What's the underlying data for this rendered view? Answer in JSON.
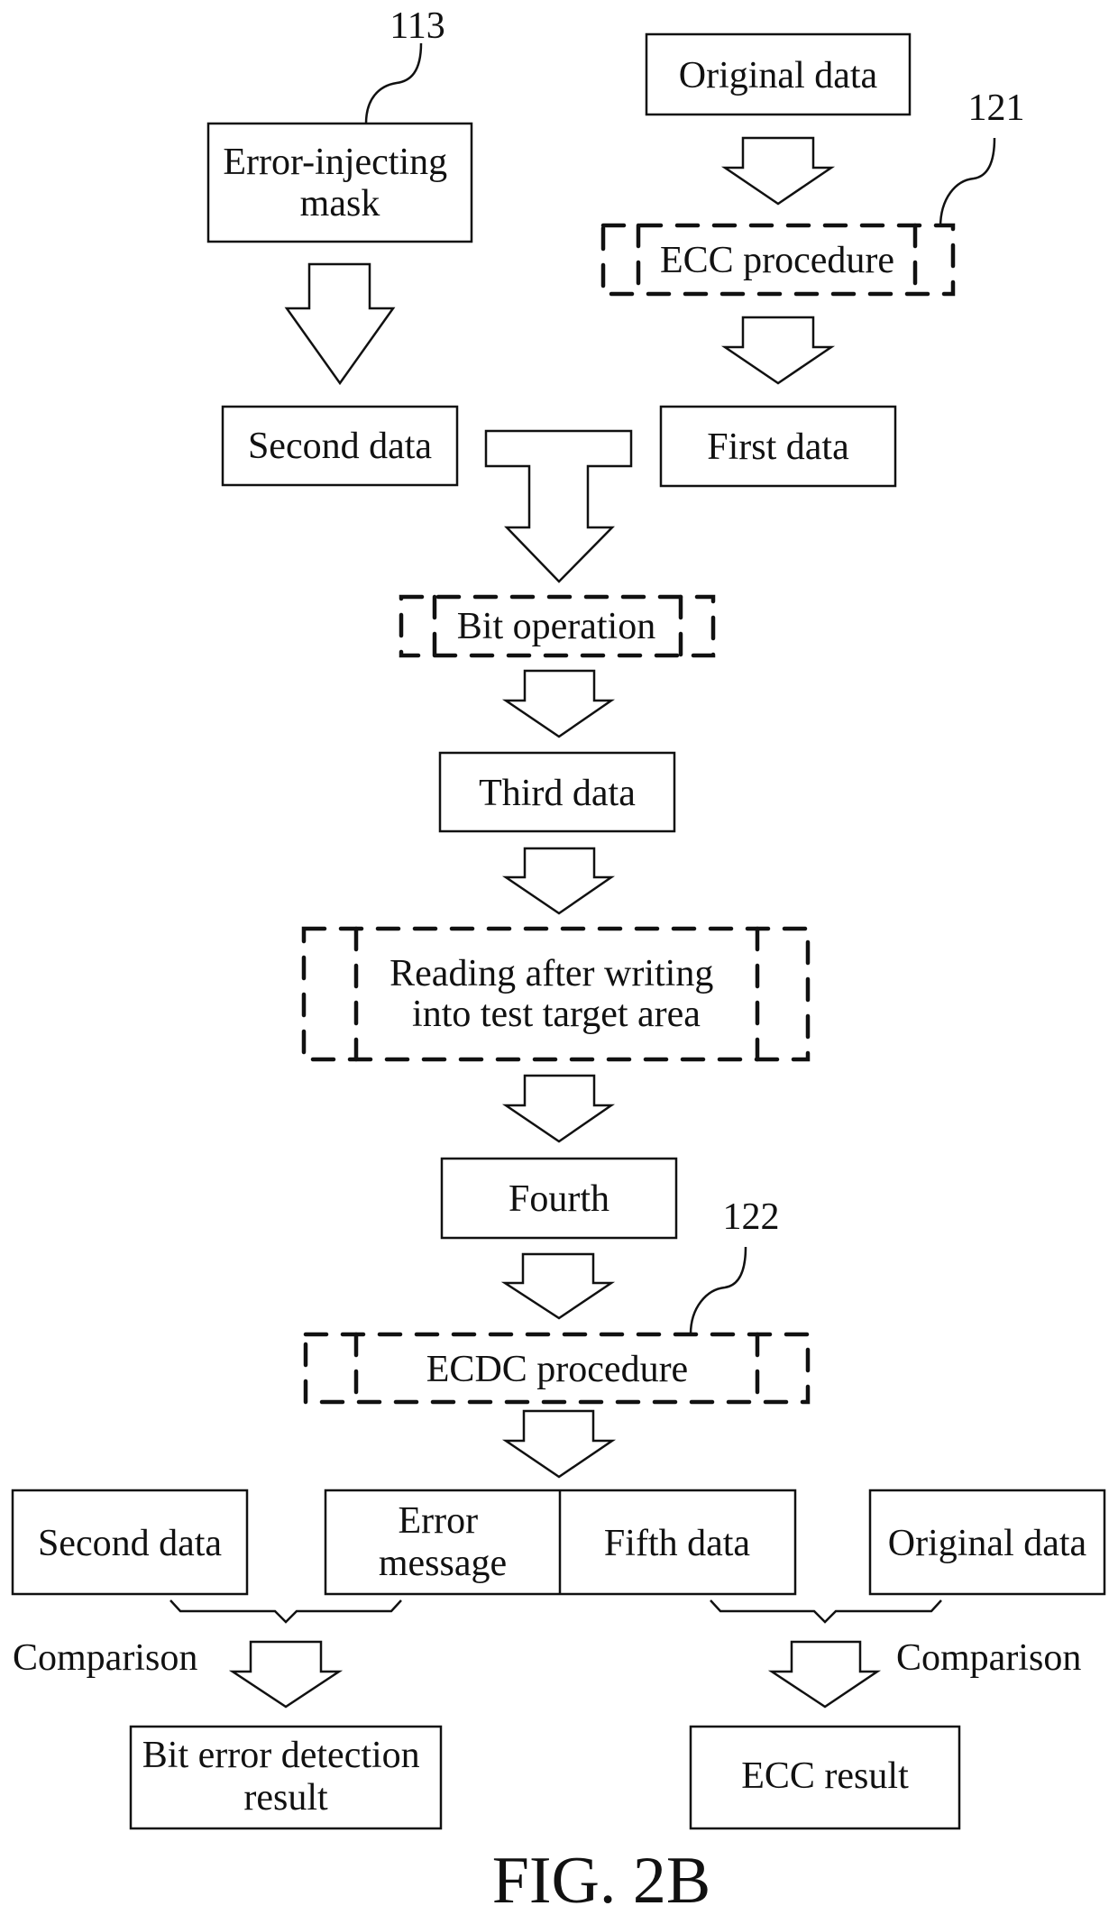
{
  "figure": {
    "caption": "FIG. 2B",
    "reference_numerals": {
      "mask": "113",
      "ecc_procedure": "121",
      "ecdc_procedure": "122"
    }
  },
  "nodes": {
    "error_injecting_mask": {
      "lines": [
        "Error-injecting",
        "mask"
      ]
    },
    "original_data_top": {
      "label": "Original data"
    },
    "ecc_procedure": {
      "label": "ECC procedure",
      "style": "dashed"
    },
    "second_data_top": {
      "label": "Second data"
    },
    "first_data": {
      "label": "First data"
    },
    "bit_operation": {
      "label": "Bit operation",
      "style": "dashed"
    },
    "third_data": {
      "label": "Third data"
    },
    "reading_after_writing": {
      "lines": [
        "Reading after writing",
        "into test target area"
      ],
      "style": "dashed"
    },
    "fourth": {
      "label": "Fourth"
    },
    "ecdc_procedure": {
      "label": "ECDC procedure",
      "style": "dashed"
    },
    "second_data_bottom": {
      "label": "Second data"
    },
    "error_message": {
      "lines": [
        "Error",
        "message"
      ]
    },
    "fifth_data": {
      "label": "Fifth data"
    },
    "original_data_bottom": {
      "label": "Original data"
    },
    "bit_error_detection_result": {
      "lines": [
        "Bit error detection",
        "result"
      ]
    },
    "ecc_result": {
      "label": "ECC result"
    }
  },
  "labels": {
    "comparison_left": "Comparison",
    "comparison_right": "Comparison"
  },
  "edges": [
    {
      "from": "error_injecting_mask",
      "to": "second_data_top"
    },
    {
      "from": "original_data_top",
      "to": "ecc_procedure"
    },
    {
      "from": "ecc_procedure",
      "to": "first_data"
    },
    {
      "from": [
        "second_data_top",
        "first_data"
      ],
      "to": "bit_operation"
    },
    {
      "from": "bit_operation",
      "to": "third_data"
    },
    {
      "from": "third_data",
      "to": "reading_after_writing"
    },
    {
      "from": "reading_after_writing",
      "to": "fourth"
    },
    {
      "from": "fourth",
      "to": "ecdc_procedure"
    },
    {
      "from": "ecdc_procedure",
      "to": [
        "error_message",
        "fifth_data"
      ]
    },
    {
      "from": [
        "second_data_bottom",
        "error_message"
      ],
      "to": "bit_error_detection_result",
      "label": "Comparison"
    },
    {
      "from": [
        "fifth_data",
        "original_data_bottom"
      ],
      "to": "ecc_result",
      "label": "Comparison"
    }
  ]
}
